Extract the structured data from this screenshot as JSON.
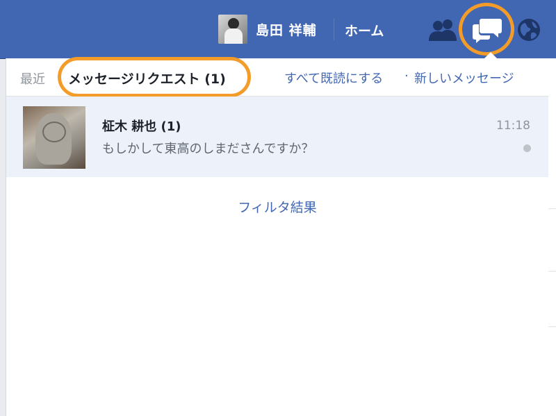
{
  "topbar": {
    "user_name": "島田 祥輔",
    "home_label": "ホーム",
    "icons": [
      "friends-icon",
      "messages-icon",
      "globe-icon"
    ],
    "accent_color": "#4267b2",
    "highlight_color": "#f39c2a"
  },
  "messages_panel": {
    "tabs": {
      "recent": "最近",
      "requests": "メッセージリクエスト (1)"
    },
    "actions": {
      "mark_all_read": "すべて既読にする",
      "separator": "·",
      "new_message": "新しいメッセージ"
    },
    "threads": [
      {
        "name": "柾木 耕也 (1)",
        "snippet": "もしかして東高のしまださんですか？",
        "time": "11:18"
      }
    ],
    "filter_results": "フィルタ結果"
  }
}
